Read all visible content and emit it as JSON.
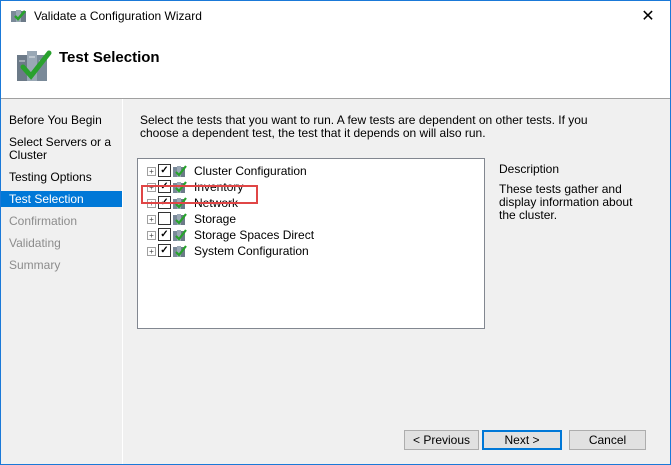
{
  "window": {
    "title": "Validate a Configuration Wizard",
    "close_glyph": "✕"
  },
  "header": {
    "title": "Test Selection"
  },
  "nav": {
    "items": [
      {
        "label": "Before You Begin",
        "state": "normal"
      },
      {
        "label": "Select Servers or a Cluster",
        "state": "normal"
      },
      {
        "label": "Testing Options",
        "state": "normal"
      },
      {
        "label": "Test Selection",
        "state": "selected"
      },
      {
        "label": "Confirmation",
        "state": "disabled"
      },
      {
        "label": "Validating",
        "state": "disabled"
      },
      {
        "label": "Summary",
        "state": "disabled"
      }
    ]
  },
  "main": {
    "instructions": "Select the tests that you want to run.  A few tests are dependent on other tests.  If you choose a dependent test, the test that it depends on will also run.",
    "tests": [
      {
        "label": "Cluster Configuration",
        "checked": true
      },
      {
        "label": "Inventory",
        "checked": true
      },
      {
        "label": "Network",
        "checked": true
      },
      {
        "label": "Storage",
        "checked": false
      },
      {
        "label": "Storage Spaces Direct",
        "checked": true
      },
      {
        "label": "System Configuration",
        "checked": true
      }
    ],
    "description": {
      "title": "Description",
      "text": "These tests gather and display information about the cluster."
    }
  },
  "buttons": {
    "previous": "< Previous",
    "next": "Next >",
    "cancel": "Cancel"
  },
  "colors": {
    "selection": "#0078d7",
    "highlight": "#e04646",
    "border": "#1a79d8"
  }
}
